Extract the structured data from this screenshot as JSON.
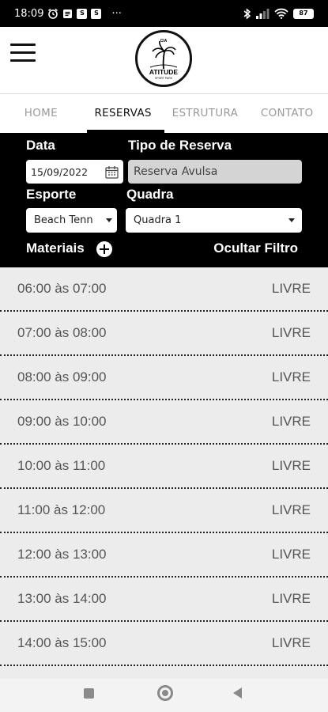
{
  "status_bar": {
    "time": "18:09",
    "battery": "87",
    "more": "···"
  },
  "logo": {
    "top_text": "CIA",
    "name": "ATITUDE",
    "sub": "SPORT PARK"
  },
  "tabs": [
    {
      "label": "HOME"
    },
    {
      "label": "RESERVAS"
    },
    {
      "label": "ESTRUTURA"
    },
    {
      "label": "CONTATO"
    }
  ],
  "filter": {
    "data_label": "Data",
    "data_value": "15/09/2022",
    "tipo_label": "Tipo de Reserva",
    "tipo_value": "Reserva Avulsa",
    "esporte_label": "Esporte",
    "esporte_value": "Beach Tenn",
    "quadra_label": "Quadra",
    "quadra_value": "Quadra 1",
    "materiais_label": "Materiais",
    "ocultar_label": "Ocultar Filtro"
  },
  "slots": [
    {
      "time": "06:00 às 07:00",
      "status": "LIVRE"
    },
    {
      "time": "07:00 às 08:00",
      "status": "LIVRE"
    },
    {
      "time": "08:00 às 09:00",
      "status": "LIVRE"
    },
    {
      "time": "09:00 às 10:00",
      "status": "LIVRE"
    },
    {
      "time": "10:00 às 11:00",
      "status": "LIVRE"
    },
    {
      "time": "11:00 às 12:00",
      "status": "LIVRE"
    },
    {
      "time": "12:00 às 13:00",
      "status": "LIVRE"
    },
    {
      "time": "13:00 às 14:00",
      "status": "LIVRE"
    },
    {
      "time": "14:00 às 15:00",
      "status": "LIVRE"
    }
  ]
}
